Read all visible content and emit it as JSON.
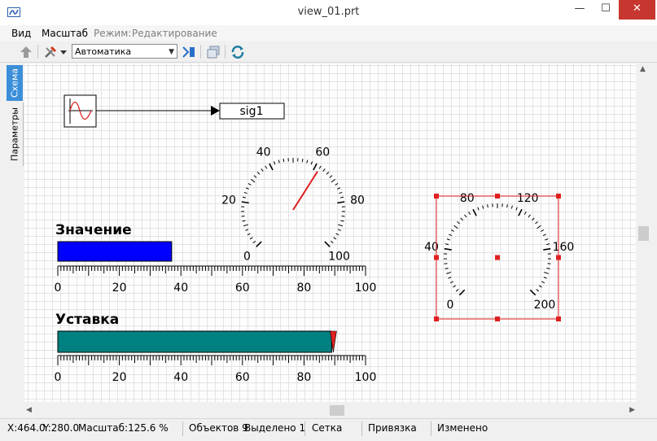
{
  "window": {
    "title": "view_01.prt",
    "minimize_glyph": "—",
    "maximize_glyph": "☐",
    "close_glyph": "✕"
  },
  "menu": {
    "items": [
      "Вид",
      "Масштаб"
    ],
    "mode_label": "Режим:",
    "mode_value": "Редактирование"
  },
  "toolbar": {
    "mode_select": "Автоматика",
    "icons": [
      "arrow-up-icon",
      "tools-icon",
      "dropdown-arrow-icon",
      "run-icon",
      "layers-icon",
      "refresh-icon"
    ]
  },
  "side_tabs": {
    "active": "Схема",
    "inactive": "Параметры"
  },
  "canvas": {
    "signal_label": "sig1",
    "value_title": "Значение",
    "setpoint_title": "Уставка",
    "gauge1": {
      "min": 0,
      "max": 100,
      "value": 62,
      "labels": [
        "0",
        "20",
        "40",
        "60",
        "80",
        "100"
      ]
    },
    "gauge2": {
      "min": 0,
      "max": 200,
      "labels": [
        "0",
        "40",
        "80",
        "120",
        "160",
        "200"
      ]
    },
    "bar_value": {
      "min": 0,
      "max": 100,
      "value": 37,
      "color": "#0000ff",
      "labels": [
        "0",
        "20",
        "40",
        "60",
        "80",
        "100"
      ]
    },
    "bar_setpoint": {
      "min": 0,
      "max": 100,
      "value": 89,
      "color": "#008080",
      "marker_color": "#e02020",
      "labels": [
        "0",
        "20",
        "40",
        "60",
        "80",
        "100"
      ]
    },
    "selection_color": "#e02020"
  },
  "status": {
    "x": "X:464.0",
    "y": "Y:280.0",
    "zoom": "Масштаб:125.6 %",
    "objects": "Объектов 9",
    "selected": "Выделено 1",
    "grid": "Сетка",
    "snap": "Привязка",
    "changed": "Изменено"
  }
}
